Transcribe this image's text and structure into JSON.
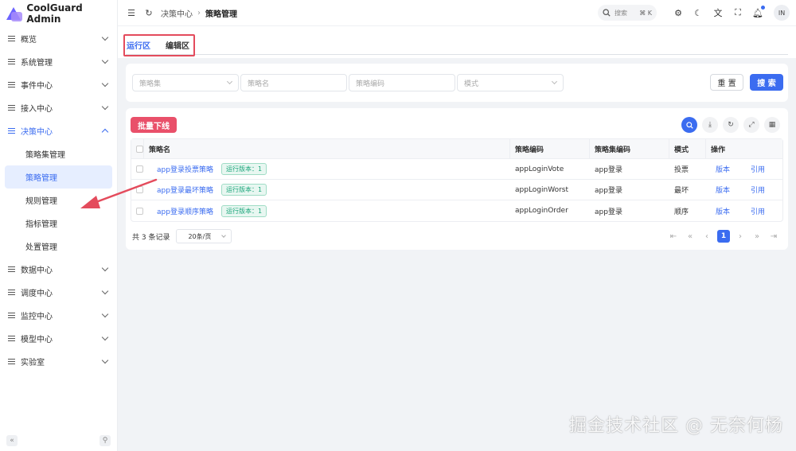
{
  "app": {
    "title": "CoolGuard Admin"
  },
  "sidebar": {
    "items": [
      {
        "label": "概览"
      },
      {
        "label": "系统管理"
      },
      {
        "label": "事件中心"
      },
      {
        "label": "接入中心"
      },
      {
        "label": "决策中心"
      },
      {
        "label": "数据中心"
      },
      {
        "label": "调度中心"
      },
      {
        "label": "监控中心"
      },
      {
        "label": "模型中心"
      },
      {
        "label": "实验室"
      }
    ],
    "sub_items": [
      {
        "label": "策略集管理"
      },
      {
        "label": "策略管理"
      },
      {
        "label": "规则管理"
      },
      {
        "label": "指标管理"
      },
      {
        "label": "处置管理"
      }
    ],
    "collapse_icon": "«",
    "pin_icon": "⚲"
  },
  "header": {
    "breadcrumb": {
      "parent": "决策中心",
      "current": "策略管理"
    },
    "search": {
      "placeholder": "搜索",
      "shortcut": "⌘ K"
    },
    "avatar": "IN"
  },
  "tabs": [
    {
      "label": "运行区"
    },
    {
      "label": "编辑区"
    }
  ],
  "filters": {
    "policy_set": "策略集",
    "policy_name": "策略名",
    "policy_code": "策略编码",
    "mode": "模式",
    "reset_label": "重 置",
    "search_label": "搜 索"
  },
  "table": {
    "bulk_label": "批量下线",
    "columns": [
      "策略名",
      "策略编码",
      "策略集编码",
      "模式",
      "操作"
    ],
    "rows": [
      {
        "name": "app登录投票策略",
        "badge": "运行版本：1",
        "code": "appLoginVote",
        "set": "app登录",
        "mode": "投票",
        "op1": "版本",
        "op2": "引用"
      },
      {
        "name": "app登录最坏策略",
        "badge": "运行版本：1",
        "code": "appLoginWorst",
        "set": "app登录",
        "mode": "最坏",
        "op1": "版本",
        "op2": "引用"
      },
      {
        "name": "app登录顺序策略",
        "badge": "运行版本：1",
        "code": "appLoginOrder",
        "set": "app登录",
        "mode": "顺序",
        "op1": "版本",
        "op2": "引用"
      }
    ]
  },
  "pagination": {
    "total": "共 3 条记录",
    "page_size": "20条/页",
    "current": "1"
  },
  "watermark": "掘金技术社区 @ 无奈何杨",
  "colors": {
    "primary": "#3b6cf0",
    "danger": "#e9506a",
    "highlight": "#e44b5c"
  }
}
